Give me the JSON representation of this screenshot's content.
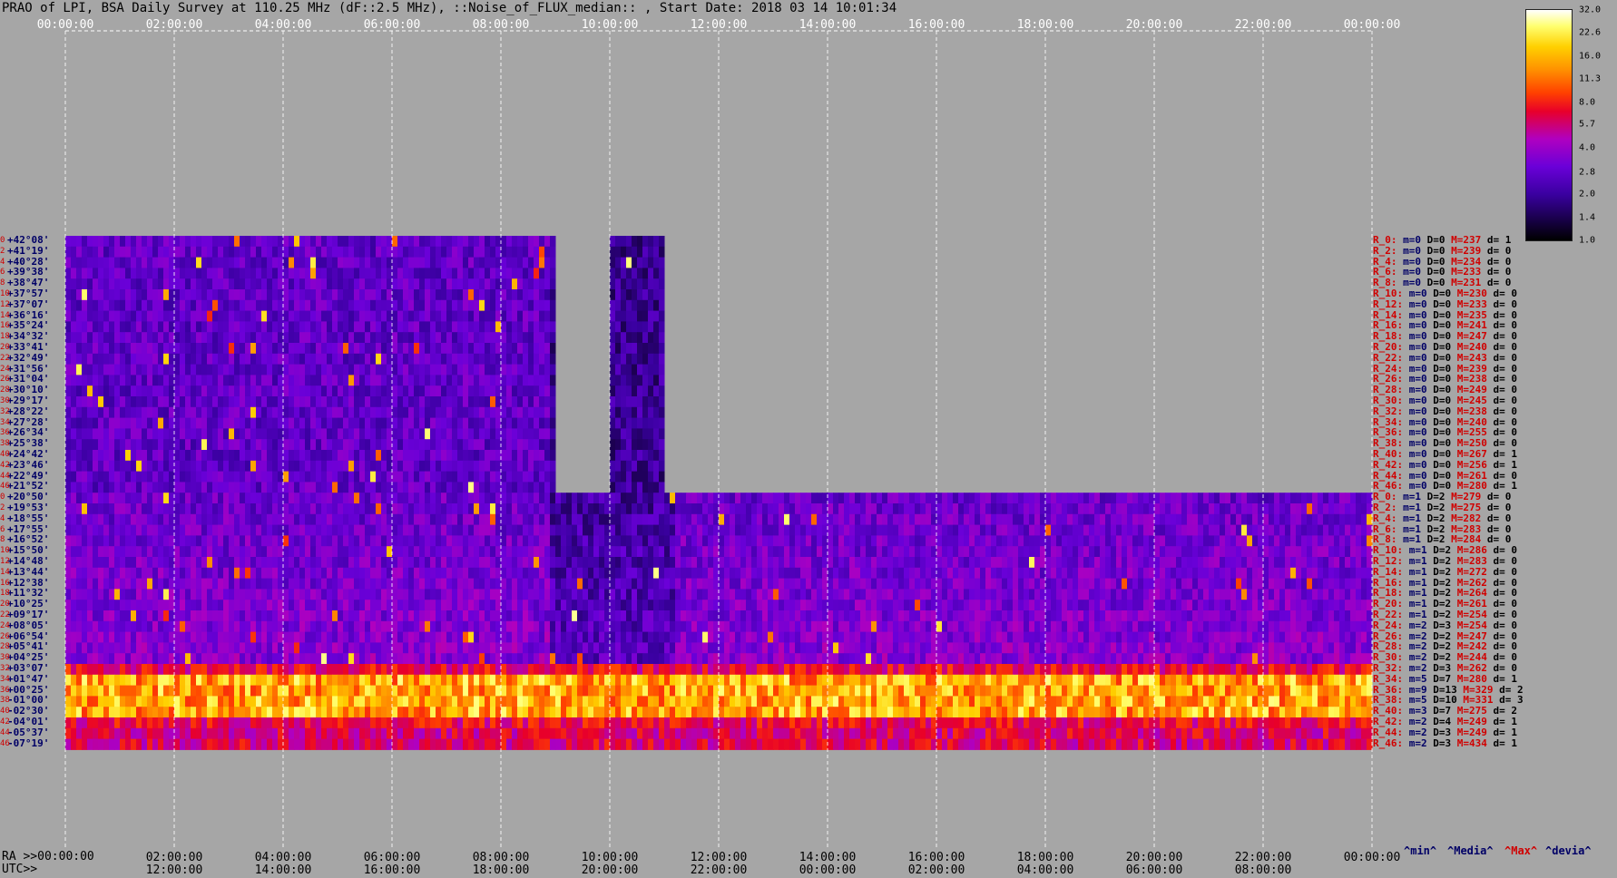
{
  "chart_data": {
    "type": "heatmap",
    "title": "PRAO of LPI, BSA Daily Survey at 110.25 MHz (dF::2.5 MHz), ::Noise_of_FLUX_median:: , Start Date: 2018 03 14 10:01:34",
    "x_top_ticks": [
      "00:00:00",
      "02:00:00",
      "04:00:00",
      "06:00:00",
      "08:00:00",
      "10:00:00",
      "12:00:00",
      "14:00:00",
      "16:00:00",
      "18:00:00",
      "20:00:00",
      "22:00:00",
      "00:00:00"
    ],
    "ra_label": "RA >>00:00:00",
    "utc_label": "UTC>>",
    "x_bottom_ra_ticks": [
      "02:00:00",
      "04:00:00",
      "06:00:00",
      "08:00:00",
      "10:00:00",
      "12:00:00",
      "14:00:00",
      "16:00:00",
      "18:00:00",
      "20:00:00",
      "22:00:00",
      "00:00:00"
    ],
    "x_bottom_utc_ticks": [
      "12:00:00",
      "14:00:00",
      "16:00:00",
      "18:00:00",
      "20:00:00",
      "22:00:00",
      "00:00:00",
      "02:00:00",
      "04:00:00",
      "06:00:00",
      "08:00:00"
    ],
    "y_dec_ticks": [
      "+42°08'",
      "+41°19'",
      "+40°28'",
      "+39°38'",
      "+38°47'",
      "+37°57'",
      "+37°07'",
      "+36°16'",
      "+35°24'",
      "+34°32'",
      "+33°41'",
      "+32°49'",
      "+31°56'",
      "+31°04'",
      "+30°10'",
      "+29°17'",
      "+28°22'",
      "+27°28'",
      "+26°34'",
      "+25°38'",
      "+24°42'",
      "+23°46'",
      "+22°49'",
      "+21°52'",
      "+20°50'",
      "+19°53'",
      "+18°55'",
      "+17°55'",
      "+16°52'",
      "+15°50'",
      "+14°48'",
      "+13°44'",
      "+12°38'",
      "+11°32'",
      "+10°25'",
      "+09°17'",
      "+08°05'",
      "+06°54'",
      "+05°41'",
      "+04°25'",
      "+03°07'",
      "+01°47'",
      "+00°25'",
      "-01°00'",
      "-02°30'",
      "-04°01'",
      "-05°37'",
      "-07°19'"
    ],
    "row_indices": [
      "0",
      "2",
      "4",
      "6",
      "8",
      "10",
      "12",
      "14",
      "16",
      "18",
      "20",
      "22",
      "24",
      "26",
      "28",
      "30",
      "32",
      "34",
      "36",
      "38",
      "40",
      "42",
      "44",
      "46",
      "0",
      "2",
      "4",
      "6",
      "8",
      "10",
      "12",
      "14",
      "16",
      "18",
      "20",
      "22",
      "24",
      "26",
      "28",
      "30",
      "32",
      "34",
      "36",
      "38",
      "40",
      "42",
      "44",
      "46"
    ],
    "colorbar_ticks": [
      "32.0",
      "22.6",
      "16.0",
      "11.3",
      "8.0",
      "5.7",
      "4.0",
      "2.8",
      "2.0",
      "1.4",
      "1.0"
    ],
    "colorbar_range": [
      1.0,
      32.0
    ],
    "colorbar_scale": "log",
    "stats_rows": [
      {
        "r": "R_0:",
        "m": "m=0",
        "D": "D=0",
        "M": "M=237",
        "d": "d= 1"
      },
      {
        "r": "R_2:",
        "m": "m=0",
        "D": "D=0",
        "M": "M=239",
        "d": "d= 0"
      },
      {
        "r": "R_4:",
        "m": "m=0",
        "D": "D=0",
        "M": "M=234",
        "d": "d= 0"
      },
      {
        "r": "R_6:",
        "m": "m=0",
        "D": "D=0",
        "M": "M=233",
        "d": "d= 0"
      },
      {
        "r": "R_8:",
        "m": "m=0",
        "D": "D=0",
        "M": "M=231",
        "d": "d= 0"
      },
      {
        "r": "R_10:",
        "m": "m=0",
        "D": "D=0",
        "M": "M=230",
        "d": "d= 0"
      },
      {
        "r": "R_12:",
        "m": "m=0",
        "D": "D=0",
        "M": "M=233",
        "d": "d= 0"
      },
      {
        "r": "R_14:",
        "m": "m=0",
        "D": "D=0",
        "M": "M=235",
        "d": "d= 0"
      },
      {
        "r": "R_16:",
        "m": "m=0",
        "D": "D=0",
        "M": "M=241",
        "d": "d= 0"
      },
      {
        "r": "R_18:",
        "m": "m=0",
        "D": "D=0",
        "M": "M=247",
        "d": "d= 0"
      },
      {
        "r": "R_20:",
        "m": "m=0",
        "D": "D=0",
        "M": "M=240",
        "d": "d= 0"
      },
      {
        "r": "R_22:",
        "m": "m=0",
        "D": "D=0",
        "M": "M=243",
        "d": "d= 0"
      },
      {
        "r": "R_24:",
        "m": "m=0",
        "D": "D=0",
        "M": "M=239",
        "d": "d= 0"
      },
      {
        "r": "R_26:",
        "m": "m=0",
        "D": "D=0",
        "M": "M=238",
        "d": "d= 0"
      },
      {
        "r": "R_28:",
        "m": "m=0",
        "D": "D=0",
        "M": "M=249",
        "d": "d= 0"
      },
      {
        "r": "R_30:",
        "m": "m=0",
        "D": "D=0",
        "M": "M=245",
        "d": "d= 0"
      },
      {
        "r": "R_32:",
        "m": "m=0",
        "D": "D=0",
        "M": "M=238",
        "d": "d= 0"
      },
      {
        "r": "R_34:",
        "m": "m=0",
        "D": "D=0",
        "M": "M=240",
        "d": "d= 0"
      },
      {
        "r": "R_36:",
        "m": "m=0",
        "D": "D=0",
        "M": "M=255",
        "d": "d= 0"
      },
      {
        "r": "R_38:",
        "m": "m=0",
        "D": "D=0",
        "M": "M=250",
        "d": "d= 0"
      },
      {
        "r": "R_40:",
        "m": "m=0",
        "D": "D=0",
        "M": "M=267",
        "d": "d= 1"
      },
      {
        "r": "R_42:",
        "m": "m=0",
        "D": "D=0",
        "M": "M=256",
        "d": "d= 1"
      },
      {
        "r": "R_44:",
        "m": "m=0",
        "D": "D=0",
        "M": "M=261",
        "d": "d= 0"
      },
      {
        "r": "R_46:",
        "m": "m=0",
        "D": "D=0",
        "M": "M=280",
        "d": "d= 1"
      },
      {
        "r": "R_0:",
        "m": "m=1",
        "D": "D=2",
        "M": "M=279",
        "d": "d= 0"
      },
      {
        "r": "R_2:",
        "m": "m=1",
        "D": "D=2",
        "M": "M=275",
        "d": "d= 0"
      },
      {
        "r": "R_4:",
        "m": "m=1",
        "D": "D=2",
        "M": "M=282",
        "d": "d= 0"
      },
      {
        "r": "R_6:",
        "m": "m=1",
        "D": "D=2",
        "M": "M=283",
        "d": "d= 0"
      },
      {
        "r": "R_8:",
        "m": "m=1",
        "D": "D=2",
        "M": "M=284",
        "d": "d= 0"
      },
      {
        "r": "R_10:",
        "m": "m=1",
        "D": "D=2",
        "M": "M=286",
        "d": "d= 0"
      },
      {
        "r": "R_12:",
        "m": "m=1",
        "D": "D=2",
        "M": "M=283",
        "d": "d= 0"
      },
      {
        "r": "R_14:",
        "m": "m=1",
        "D": "D=2",
        "M": "M=272",
        "d": "d= 0"
      },
      {
        "r": "R_16:",
        "m": "m=1",
        "D": "D=2",
        "M": "M=262",
        "d": "d= 0"
      },
      {
        "r": "R_18:",
        "m": "m=1",
        "D": "D=2",
        "M": "M=264",
        "d": "d= 0"
      },
      {
        "r": "R_20:",
        "m": "m=1",
        "D": "D=2",
        "M": "M=261",
        "d": "d= 0"
      },
      {
        "r": "R_22:",
        "m": "m=1",
        "D": "D=2",
        "M": "M=254",
        "d": "d= 0"
      },
      {
        "r": "R_24:",
        "m": "m=2",
        "D": "D=3",
        "M": "M=254",
        "d": "d= 0"
      },
      {
        "r": "R_26:",
        "m": "m=2",
        "D": "D=2",
        "M": "M=247",
        "d": "d= 0"
      },
      {
        "r": "R_28:",
        "m": "m=2",
        "D": "D=2",
        "M": "M=242",
        "d": "d= 0"
      },
      {
        "r": "R_30:",
        "m": "m=2",
        "D": "D=2",
        "M": "M=244",
        "d": "d= 0"
      },
      {
        "r": "R_32:",
        "m": "m=2",
        "D": "D=3",
        "M": "M=262",
        "d": "d= 0"
      },
      {
        "r": "R_34:",
        "m": "m=5",
        "D": "D=7",
        "M": "M=280",
        "d": "d= 1"
      },
      {
        "r": "R_36:",
        "m": "m=9",
        "D": "D=13",
        "M": "M=329",
        "d": "d= 2"
      },
      {
        "r": "R_38:",
        "m": "m=5",
        "D": "D=10",
        "M": "M=331",
        "d": "d= 3"
      },
      {
        "r": "R_40:",
        "m": "m=3",
        "D": "D=7",
        "M": "M=275",
        "d": "d= 2"
      },
      {
        "r": "R_42:",
        "m": "m=2",
        "D": "D=4",
        "M": "M=249",
        "d": "d= 1"
      },
      {
        "r": "R_44:",
        "m": "m=2",
        "D": "D=3",
        "M": "M=249",
        "d": "d= 1"
      },
      {
        "r": "R_46:",
        "m": "m=2",
        "D": "D=3",
        "M": "M=434",
        "d": "d= 1"
      }
    ],
    "legend": {
      "min": "^min^",
      "median": "^Media^",
      "max": "^Max^",
      "devia": "^devia^"
    },
    "colors": {
      "legend_min": "#000066",
      "legend_median": "#000066",
      "legend_max": "#d00000",
      "legend_devia": "#000066",
      "row_label": "#d00000",
      "dec_label": "#000066"
    }
  }
}
